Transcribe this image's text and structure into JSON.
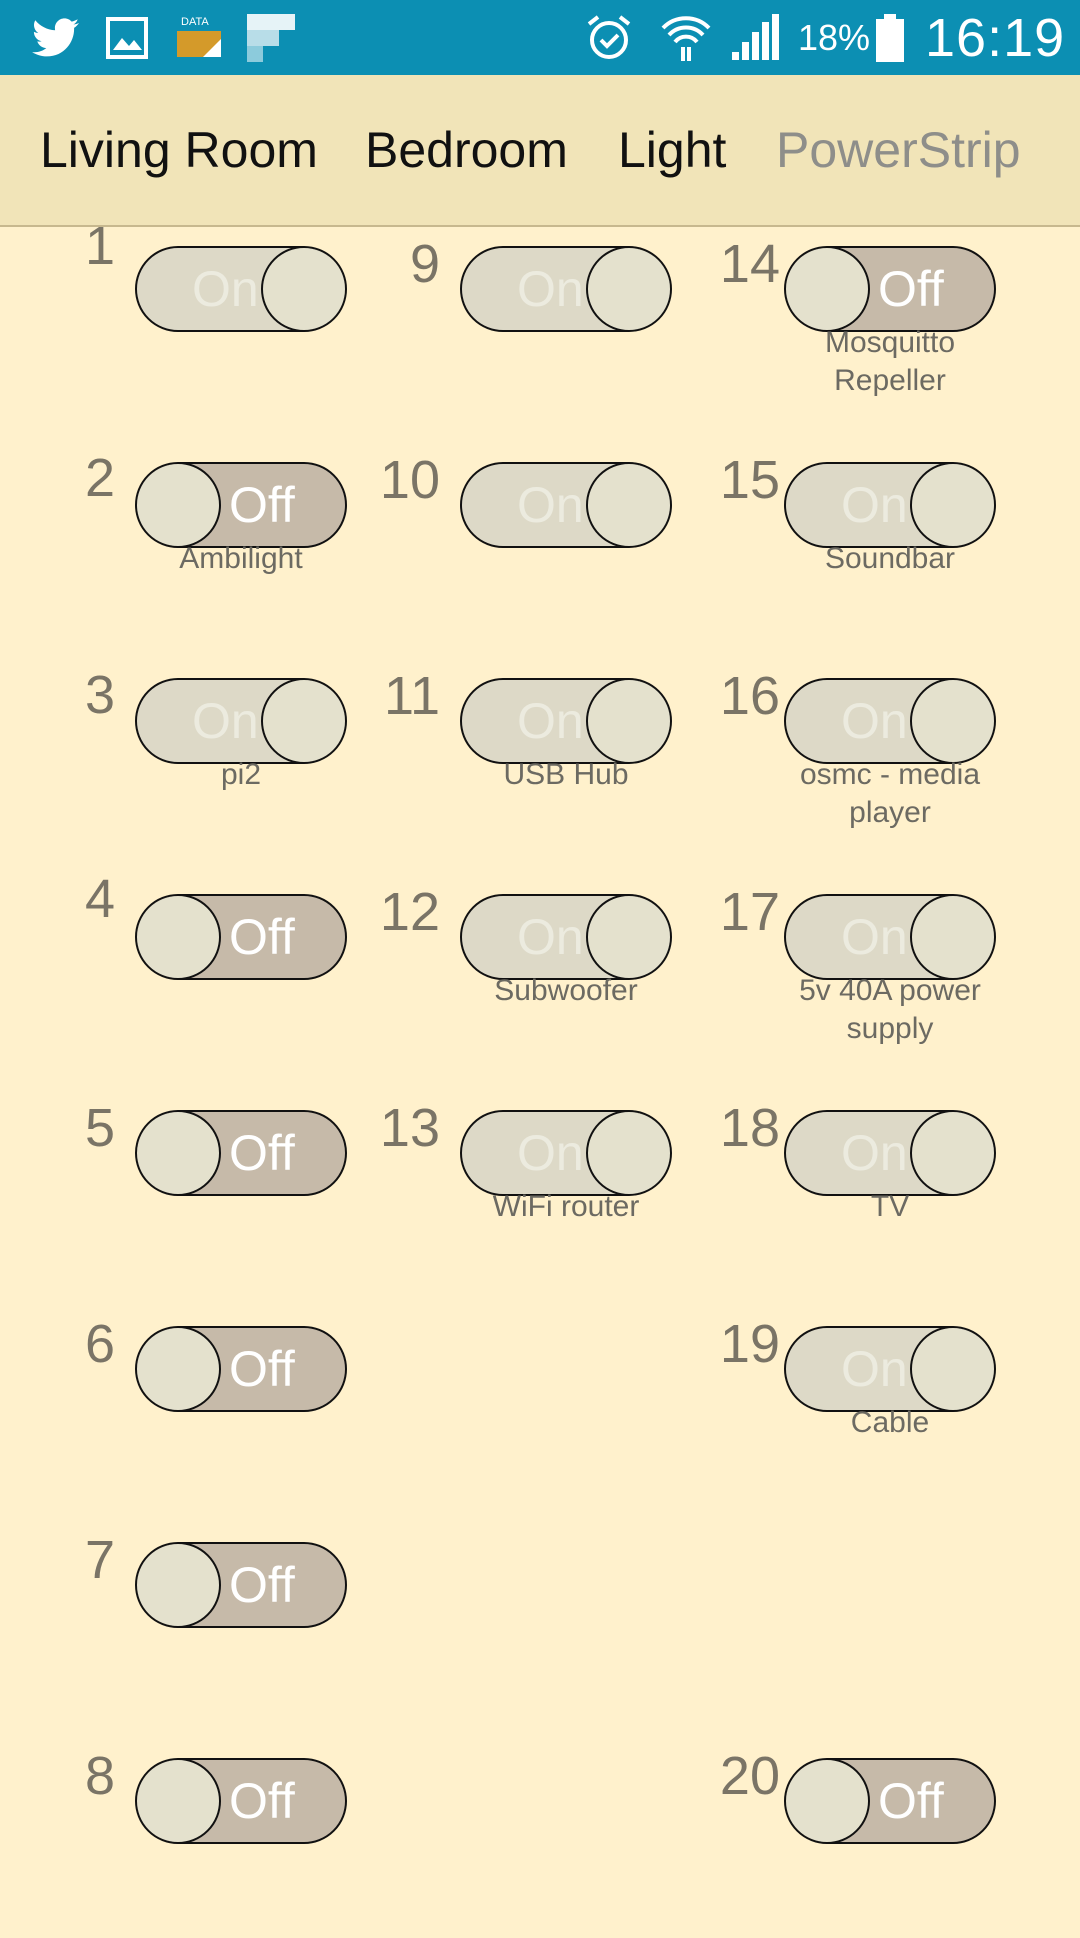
{
  "status_bar": {
    "icons": [
      "twitter-icon",
      "gallery-icon",
      "data-icon",
      "flipboard-icon",
      "alarm-icon",
      "wifi-icon",
      "signal-icon",
      "battery-icon"
    ],
    "battery": "18%",
    "time": "16:19",
    "background_color": "#0c8fb3"
  },
  "tabs": [
    {
      "label": "Living Room",
      "active": true
    },
    {
      "label": "Bedroom",
      "active": true
    },
    {
      "label": "Light",
      "active": true
    },
    {
      "label": "PowerStrip",
      "active": false
    }
  ],
  "outlets": [
    {
      "number": "1",
      "state": "On",
      "label": ""
    },
    {
      "number": "2",
      "state": "Off",
      "label": "Ambilight"
    },
    {
      "number": "3",
      "state": "On",
      "label": "pi2"
    },
    {
      "number": "4",
      "state": "Off",
      "label": ""
    },
    {
      "number": "5",
      "state": "Off",
      "label": ""
    },
    {
      "number": "6",
      "state": "Off",
      "label": ""
    },
    {
      "number": "7",
      "state": "Off",
      "label": ""
    },
    {
      "number": "8",
      "state": "Off",
      "label": ""
    },
    {
      "number": "9",
      "state": "On",
      "label": ""
    },
    {
      "number": "10",
      "state": "On",
      "label": ""
    },
    {
      "number": "11",
      "state": "On",
      "label": "USB Hub"
    },
    {
      "number": "12",
      "state": "On",
      "label": "Subwoofer"
    },
    {
      "number": "13",
      "state": "On",
      "label": "WiFi router"
    },
    {
      "number": "14",
      "state": "Off",
      "label": "Mosquitto Repeller"
    },
    {
      "number": "15",
      "state": "On",
      "label": "Soundbar"
    },
    {
      "number": "16",
      "state": "On",
      "label": "osmc - media player"
    },
    {
      "number": "17",
      "state": "On",
      "label": "5v 40A power supply"
    },
    {
      "number": "18",
      "state": "On",
      "label": "TV"
    },
    {
      "number": "19",
      "state": "On",
      "label": "Cable"
    },
    {
      "number": "20",
      "state": "Off",
      "label": ""
    }
  ],
  "colors": {
    "background": "#fff1cc",
    "tab_bar": "#f1e4b8",
    "switch_on": "#ddd9c7",
    "switch_off": "#c6baa9"
  }
}
